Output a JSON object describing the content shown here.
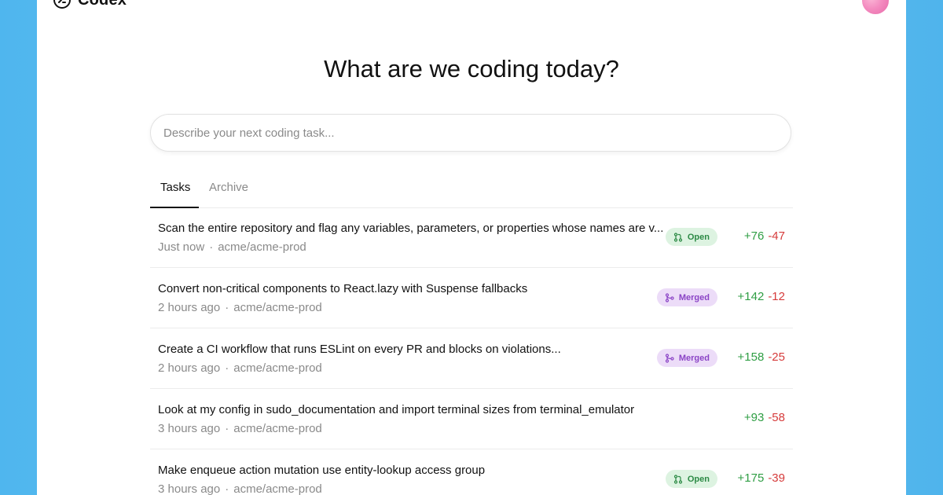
{
  "app": {
    "name": "Codex"
  },
  "main": {
    "heading": "What are we coding today?",
    "input_placeholder": "Describe your next coding task..."
  },
  "tabs": [
    {
      "label": "Tasks",
      "active": true
    },
    {
      "label": "Archive",
      "active": false
    }
  ],
  "tasks": [
    {
      "title": "Scan the entire repository and flag any variables, parameters, or properties whose names are v...",
      "time": "Just now",
      "repo": "acme/acme-prod",
      "status": "Open",
      "additions": "+76",
      "deletions": "-47"
    },
    {
      "title": "Convert non-critical components to React.lazy with Suspense fallbacks",
      "time": "2 hours ago",
      "repo": "acme/acme-prod",
      "status": "Merged",
      "additions": "+142",
      "deletions": "-12"
    },
    {
      "title": "Create a CI workflow that runs ESLint on every PR and blocks on violations...",
      "time": "2 hours ago",
      "repo": "acme/acme-prod",
      "status": "Merged",
      "additions": "+158",
      "deletions": "-25"
    },
    {
      "title": "Look at my config in sudo_documentation and import terminal sizes from terminal_emulator",
      "time": "3 hours ago",
      "repo": "acme/acme-prod",
      "status": "",
      "additions": "+93",
      "deletions": "-58"
    },
    {
      "title": "Make enqueue action mutation use entity-lookup access group",
      "time": "3 hours ago",
      "repo": "acme/acme-prod",
      "status": "Open",
      "additions": "+175",
      "deletions": "-39"
    }
  ],
  "colors": {
    "background": "#5fbdf1",
    "open_badge_bg": "#ddf3e1",
    "open_badge_text": "#2c8a45",
    "merged_badge_bg": "#ecdcf8",
    "merged_badge_text": "#8b44c6",
    "additions": "#2f9e44",
    "deletions": "#d63b3b"
  },
  "icons": {
    "logo": "codex-logo-icon",
    "open": "pull-request-icon",
    "merged": "merge-icon"
  }
}
